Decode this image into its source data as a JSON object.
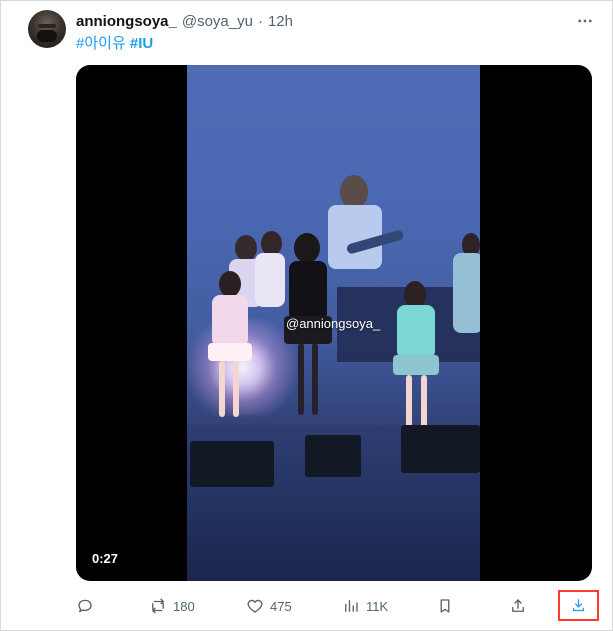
{
  "tweet": {
    "author": {
      "display_name": "anniongsoya_",
      "handle": "@soya_yu",
      "separator": "·",
      "time": "12h"
    },
    "hashtags": [
      {
        "text": "#아이유"
      },
      {
        "text": "#IU"
      }
    ],
    "media": {
      "watermark": "@anniongsoya_",
      "duration": "0:27"
    },
    "actions": {
      "retweets": "180",
      "likes": "475",
      "views": "11K"
    }
  },
  "icons": {
    "more": "more-icon",
    "reply": "reply-icon",
    "retweet": "retweet-icon",
    "like": "heart-icon",
    "views": "views-icon",
    "bookmark": "bookmark-icon",
    "share": "share-icon",
    "download": "download-icon"
  },
  "colors": {
    "accent": "#1d9bf0",
    "secondary_text": "#536471",
    "highlight_border": "#ff3b30"
  }
}
